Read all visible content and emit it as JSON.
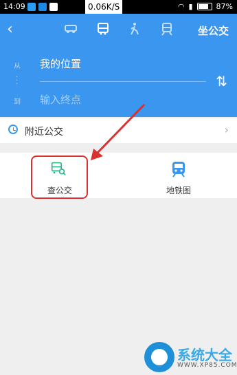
{
  "status_bar": {
    "time": "14:09",
    "net_speed": "0.06K/S",
    "battery": "87%"
  },
  "header": {
    "title": "坐公交",
    "from_label": "从",
    "to_label": "到",
    "from_value": "我的位置",
    "to_placeholder": "输入终点",
    "modes": [
      "car-icon",
      "bus-icon",
      "walk-icon",
      "train-icon"
    ]
  },
  "nearby": {
    "label": "附近公交"
  },
  "tools": [
    {
      "label": "查公交",
      "icon": "bus-search-icon",
      "color": "#2fb38a"
    },
    {
      "label": "地铁图",
      "icon": "subway-icon",
      "color": "#3b96f0"
    }
  ],
  "watermark": {
    "title": "系统大全",
    "url": "WWW.XP85.COM"
  },
  "colors": {
    "accent": "#3b96f0",
    "highlight": "#d93030",
    "page_bg": "#efefef"
  }
}
